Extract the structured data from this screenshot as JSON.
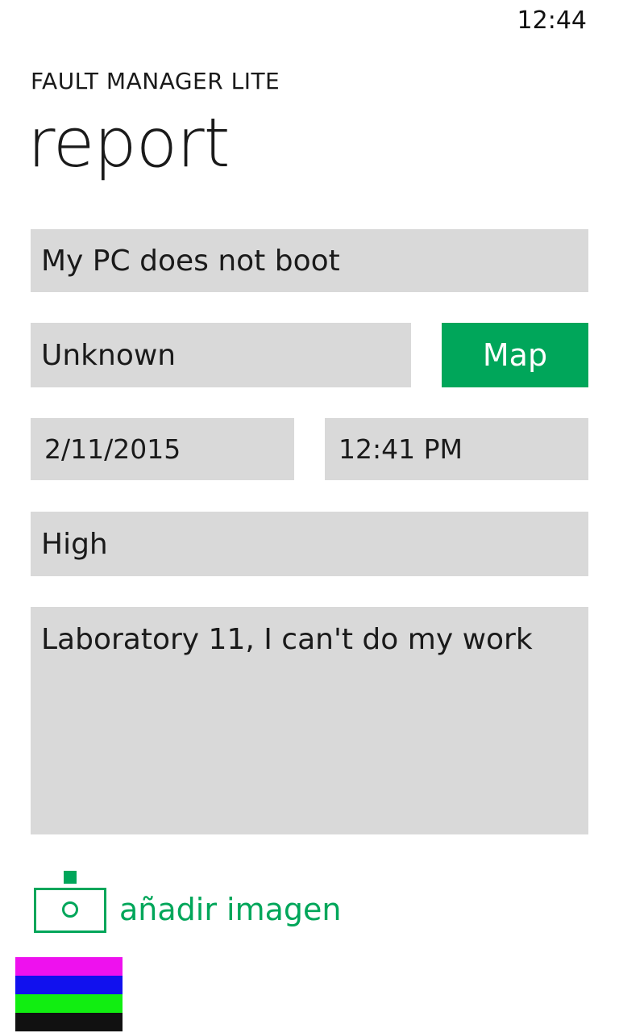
{
  "status_bar": {
    "time": "12:44"
  },
  "header": {
    "app_title": "FAULT MANAGER LITE",
    "page_title": "report"
  },
  "form": {
    "summary_value": "My PC does not boot",
    "location_value": "Unknown",
    "map_button_label": "Map",
    "date_value": "2/11/2015",
    "time_value": "12:41 PM",
    "priority_value": "High",
    "description_value": "Laboratory 11, I can't do my work"
  },
  "add_image": {
    "label": "añadir imagen",
    "icon": "camera-icon"
  },
  "colors": {
    "accent": "#00a65a",
    "field_background": "#d9d9d9",
    "bar_colors": [
      "#ee11ee",
      "#1111ee",
      "#11ee11",
      "#111111"
    ]
  }
}
